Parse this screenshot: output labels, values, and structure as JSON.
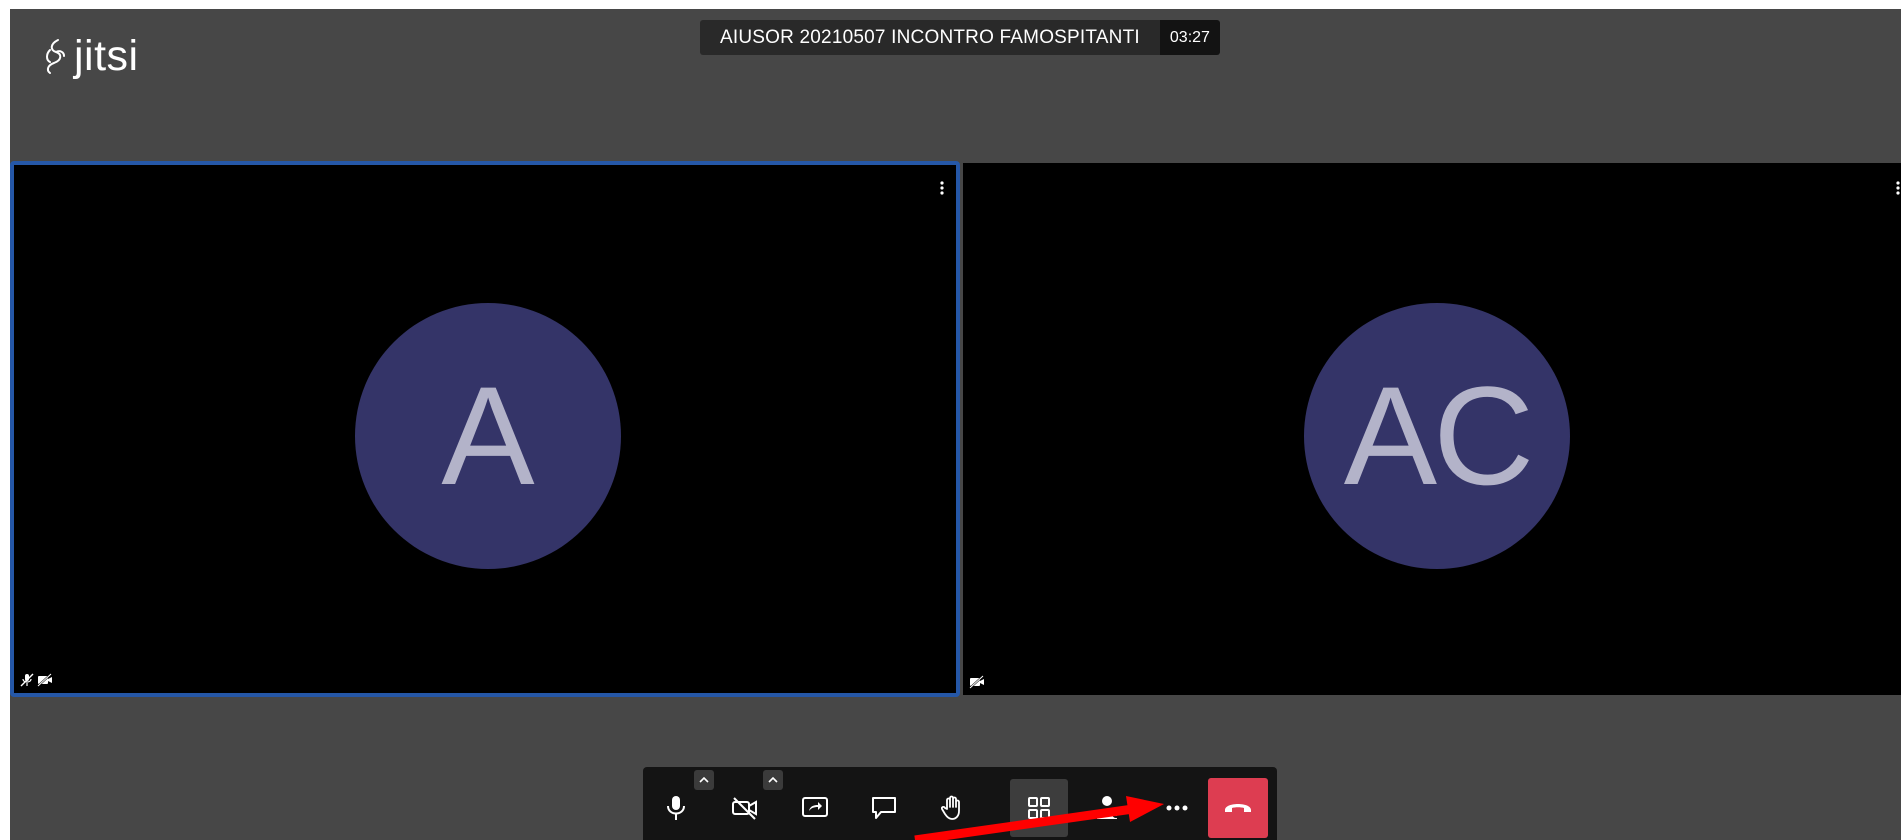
{
  "app": {
    "logo_text": "jitsi"
  },
  "meeting": {
    "subject": "AIUSOR 20210507 INCONTRO FAMOSPITANTI",
    "timer": "03:27"
  },
  "participants": [
    {
      "initials": "A",
      "audio_muted": true,
      "video_muted": true,
      "dominant": true
    },
    {
      "initials": "AC",
      "audio_muted": false,
      "video_muted": true,
      "dominant": false
    }
  ],
  "toolbar": {
    "buttons": [
      {
        "icon": "microphone-icon",
        "has_caret": true
      },
      {
        "icon": "camera-off-icon",
        "has_caret": true
      },
      {
        "icon": "share-screen-icon"
      },
      {
        "icon": "chat-icon"
      },
      {
        "icon": "raise-hand-icon"
      },
      {
        "icon": "tile-view-icon",
        "active": true
      },
      {
        "icon": "participants-icon"
      },
      {
        "icon": "more-options-icon"
      },
      {
        "icon": "hangup-icon"
      }
    ]
  },
  "colors": {
    "stage": "#474747",
    "tile": "#000000",
    "dominant_border": "#2557a7",
    "avatar": "#343468",
    "hangup": "#dd3d51",
    "annotation_arrow": "#ff0000"
  }
}
